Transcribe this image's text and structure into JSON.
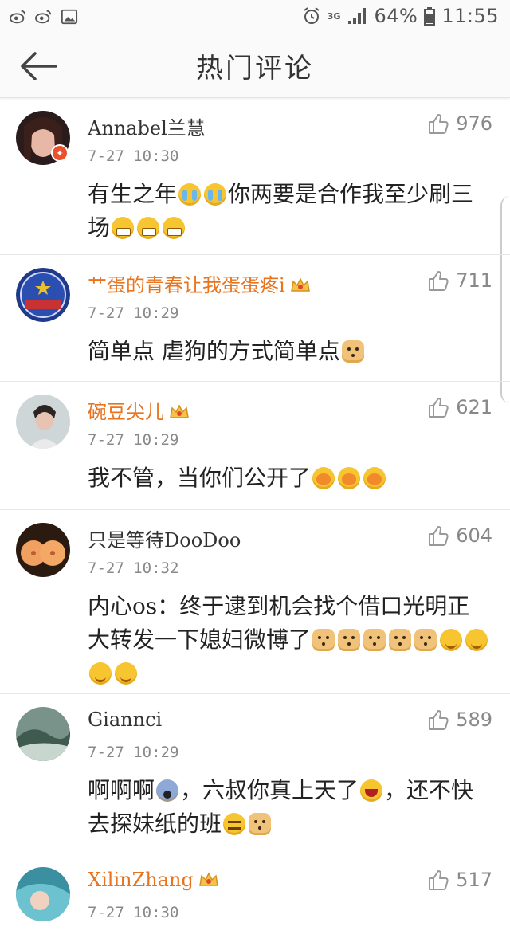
{
  "status_bar": {
    "network": "3G",
    "battery": "64%",
    "time": "11:55"
  },
  "header": {
    "title": "热门评论"
  },
  "comments": [
    {
      "name": "Annabel兰慧",
      "time": "7-27 10:30",
      "likes": "976",
      "text_parts": [
        "有生之年",
        "你两要是合作我至少刷三场",
        ""
      ]
    },
    {
      "name": "艹蛋的青春让我蛋蛋疼i",
      "time": "7-27 10:29",
      "likes": "711",
      "text_parts": [
        "简单点 虐狗的方式简单点"
      ]
    },
    {
      "name": "碗豆尖儿",
      "time": "7-27 10:29",
      "likes": "621",
      "text_parts": [
        "我不管，当你们公开了"
      ]
    },
    {
      "name": "只是等待DooDoo",
      "time": "7-27 10:32",
      "likes": "604",
      "text_parts": [
        "内心os：终于逮到机会找个借口光明正大转发一下媳妇微博了"
      ]
    },
    {
      "name": "Giannci",
      "time": "7-27 10:29",
      "likes": "589",
      "text_parts": [
        "啊啊啊",
        "，六叔你真上天了",
        "，还不快去探妹纸的班"
      ]
    },
    {
      "name": "XilinZhang",
      "time": "7-27 10:30",
      "likes": "517",
      "text_parts": []
    }
  ]
}
